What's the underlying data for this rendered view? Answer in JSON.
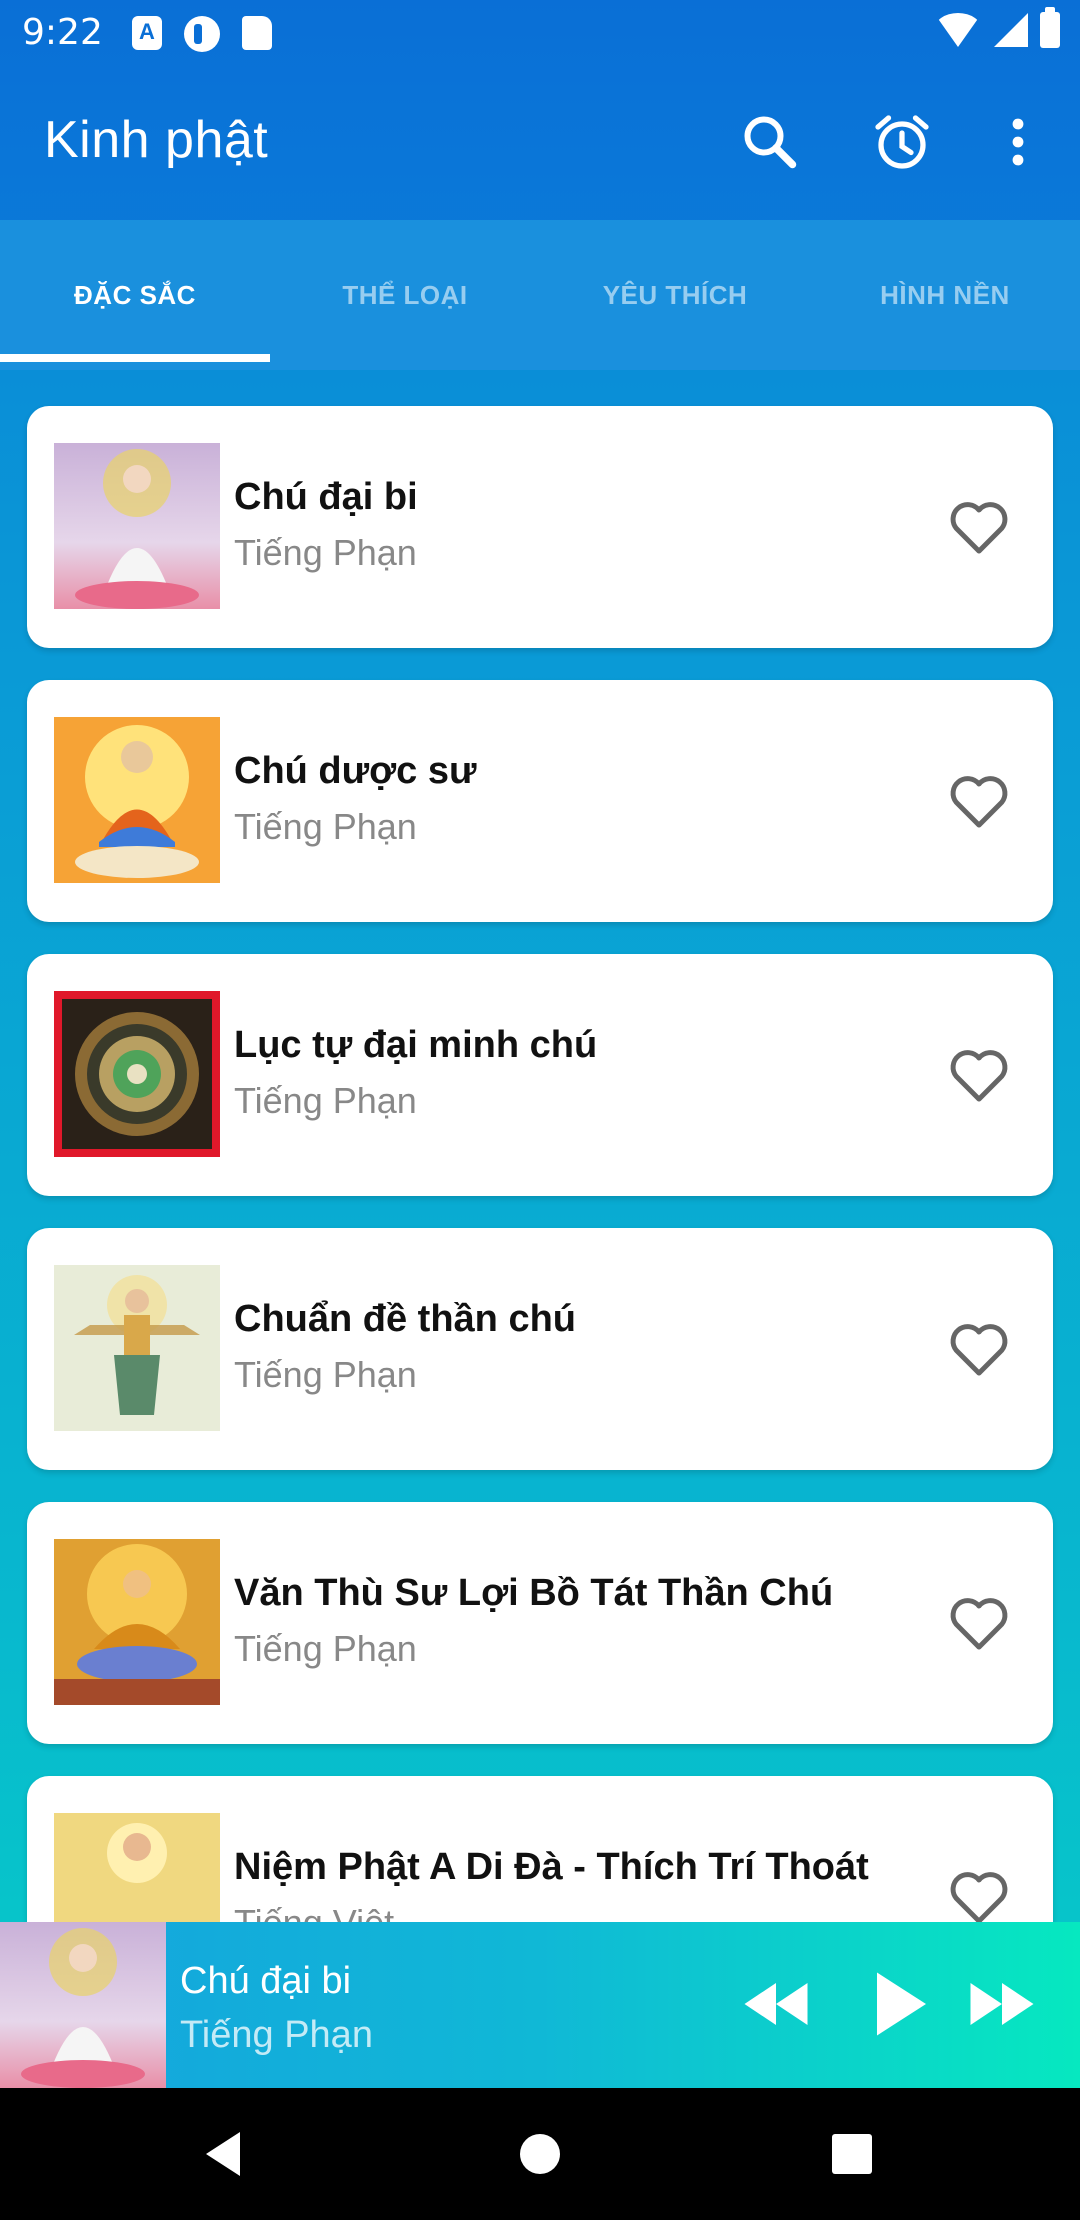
{
  "status_bar": {
    "time": "9:22"
  },
  "toolbar": {
    "title": "Kinh phật",
    "icons": [
      "search-icon",
      "alarm-icon",
      "more-vert-icon"
    ]
  },
  "tabs": [
    {
      "label": "ĐẶC SẮC",
      "active": true
    },
    {
      "label": "THỂ LOẠI",
      "active": false
    },
    {
      "label": "YÊU THÍCH",
      "active": false
    },
    {
      "label": "HÌNH NỀN",
      "active": false
    }
  ],
  "items": [
    {
      "title": "Chú đại bi",
      "subtitle": "Tiếng Phạn"
    },
    {
      "title": "Chú dược sư",
      "subtitle": "Tiếng Phạn"
    },
    {
      "title": "Lục tự đại minh chú",
      "subtitle": "Tiếng Phạn"
    },
    {
      "title": "Chuẩn đề thần chú",
      "subtitle": "Tiếng Phạn"
    },
    {
      "title": "Văn Thù Sư Lợi Bồ Tát Thần Chú",
      "subtitle": "Tiếng Phạn"
    },
    {
      "title": "Niệm Phật A Di Đà - Thích Trí Thoát",
      "subtitle": "Tiếng Việt"
    }
  ],
  "player": {
    "title": "Chú đại bi",
    "subtitle": "Tiếng Phạn"
  },
  "colors": {
    "primary": "#0a6fd6",
    "tab_bar": "#1a90dd",
    "accent_end": "#06e8c0"
  }
}
